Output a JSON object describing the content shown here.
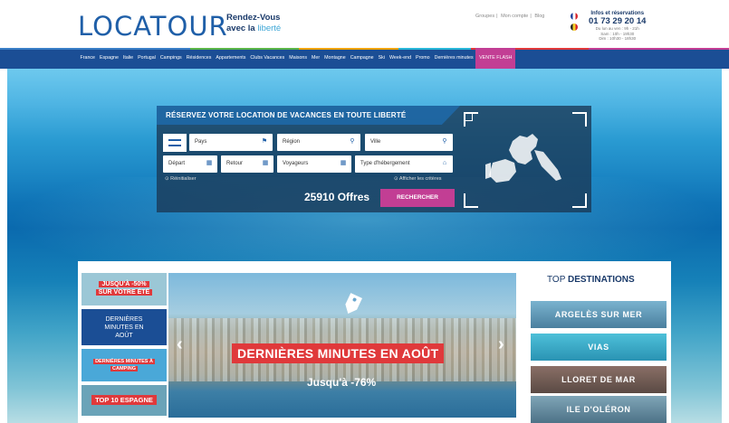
{
  "header": {
    "logo": "LOCATOUR",
    "tagline_1": "Rendez-Vous",
    "tagline_2_prefix": "avec la",
    "tagline_2_accent": "liberté",
    "toplinks": [
      "Groupes",
      "Mon compte",
      "Blog"
    ],
    "contact_label": "Infos et réservations",
    "phone": "01 73 29 20 14",
    "hours": [
      "Du lun au ven : 9h - 21h",
      "Sam : 10h - 19h30",
      "Dim : 10h30 - 18h30"
    ]
  },
  "nav": {
    "items": [
      "France",
      "Espagne",
      "Italie",
      "Portugal",
      "Campings",
      "Résidences",
      "Appartements",
      "Clubs Vacances",
      "Maisons",
      "Mer",
      "Montagne",
      "Campagne",
      "Ski",
      "Week-end",
      "Promo",
      "Dernières minutes",
      "VENTE FLASH"
    ],
    "accent_colors": [
      "#3a7fc7",
      "#e0393b",
      "#f0a400",
      "#5cb64a",
      "#c23e94",
      "#2ab7d9"
    ]
  },
  "search": {
    "title": "RÉSERVEZ VOTRE LOCATION DE VACANCES EN TOUTE LIBERTÉ",
    "pays": "Pays",
    "region": "Région",
    "ville": "Ville",
    "depart": "Départ",
    "retour": "Retour",
    "voyageurs": "Voyageurs",
    "type": "Type d'hébergement",
    "reinit": "Réinitialiser",
    "criteria": "Afficher les critères",
    "offers": "25910 Offres",
    "button": "RECHERCHER"
  },
  "promos": {
    "p1_line1": "JUSQU'À -50%",
    "p1_line2": "SUR VOTRE ÉTÉ",
    "p2_line1": "DERNIÈRES",
    "p2_line2": "MINUTES EN",
    "p2_line3": "AOÛT",
    "p3_line1": "DERNIÈRES MINUTES À",
    "p3_line2": "CAMPING",
    "p4": "TOP 10 ESPAGNE"
  },
  "carousel": {
    "title": "DERNIÈRES MINUTES EN AOÛT",
    "subtitle": "Jusqu'à -76%",
    "prev": "‹",
    "next": "›"
  },
  "destinations": {
    "heading_light": "TOP",
    "heading_bold": "DESTINATIONS",
    "items": [
      "ARGELÈS SUR MER",
      "VIAS",
      "LLORET DE MAR",
      "ILE D'OLÉRON"
    ]
  }
}
